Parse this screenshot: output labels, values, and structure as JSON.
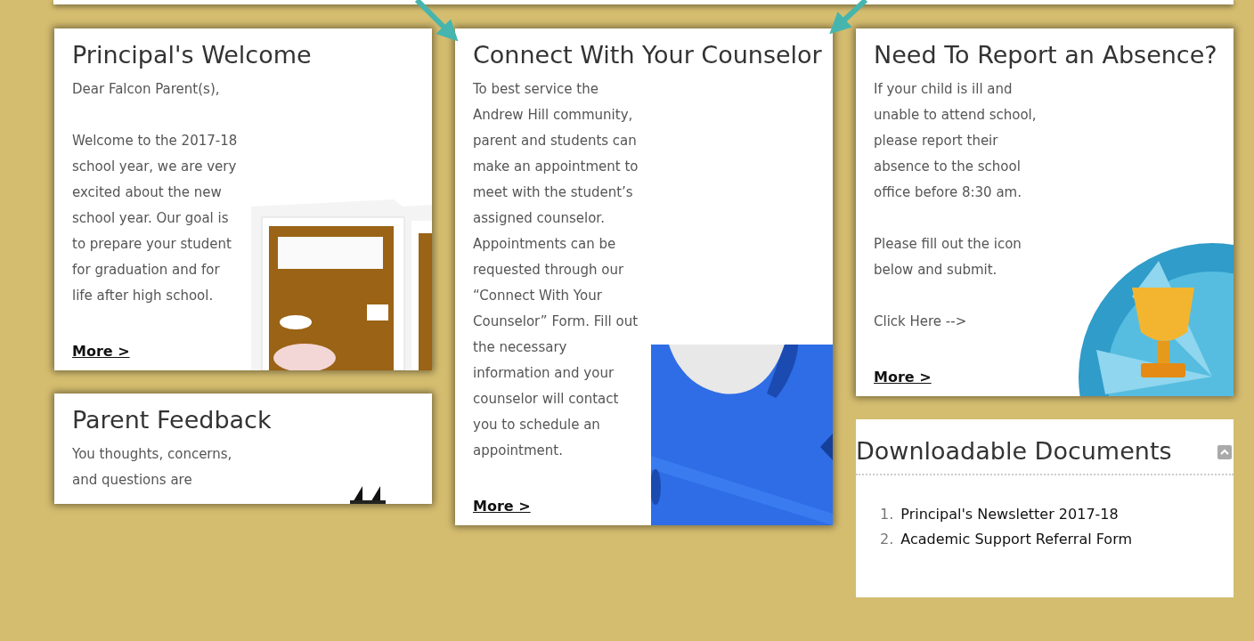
{
  "columns": [
    {
      "items": [
        {
          "kind": "card",
          "title": "Principal's Welcome",
          "paragraphs": [
            "Dear Falcon Parent(s),",
            "Welcome to the 2017-18 school year, we are very excited about the new school year. Our goal is to prepare your student for graduation and for life after high school."
          ],
          "link": "More >"
        },
        {
          "kind": "card",
          "title": "Parent Feedback",
          "paragraphs": [
            "You thoughts, concerns, and questions are"
          ]
        }
      ]
    },
    {
      "items": [
        {
          "kind": "card",
          "title": "Connect With Your Counselor",
          "paragraphs": [
            "To best service the Andrew Hill community, parent and students can make an appointment to meet with the student’s assigned counselor. Appointments can be requested through our “Connect With Your Counselor” Form. Fill out the necessary information and your counselor will contact you to schedule an appointment."
          ],
          "link": "More >"
        }
      ]
    },
    {
      "items": [
        {
          "kind": "card",
          "title": "Need To Report an Absence?",
          "paragraphs": [
            "If your child is ill and unable to attend school, please report their absence to the school office before 8:30 am.",
            "Please fill out the icon below and submit.",
            "Click Here -->"
          ],
          "link": "More >"
        },
        {
          "kind": "documents",
          "title": "Downloadable Documents",
          "documents": [
            {
              "number": "1.",
              "label": "Principal's Newsletter 2017-18"
            },
            {
              "number": "2.",
              "label": "Academic Support Referral Form"
            }
          ]
        }
      ]
    }
  ]
}
